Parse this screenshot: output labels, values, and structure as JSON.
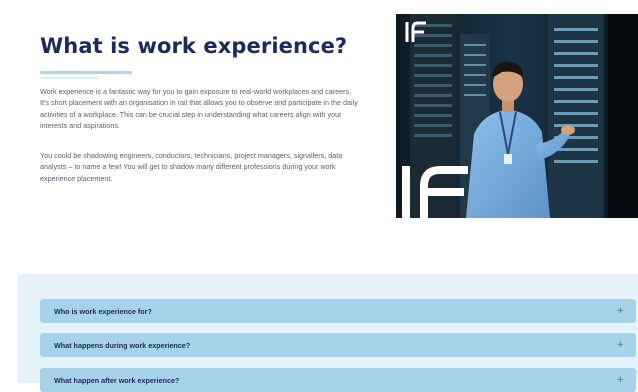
{
  "intro": {
    "heading": "What is work experience?",
    "paragraph_1": "Work experience is a fantastic way for you to gain exposure to real-world workplaces and careers. It's short placement with an organisation in rail that allows you to observe and participate in the daily activities of a workplace. This can be crucial step in understanding what careers align with your interests and aspirations.",
    "paragraph_2": "You could be shadowing engineers, conductors, technicians, project managers, signallers, data analysts – to name a few! You will get to shadow many different professions during your work experience placement."
  },
  "hero_image": {
    "icon": "person-in-server-room-photo",
    "logo_icon": "if-logo-icon"
  },
  "faq": {
    "items": [
      {
        "label": "Who is work experience for?",
        "toggle": "+"
      },
      {
        "label": "What happens during work experience?",
        "toggle": "+"
      },
      {
        "label": "What happen after work experience?",
        "toggle": "+"
      }
    ]
  },
  "colors": {
    "heading": "#1f2a5c",
    "body_text": "#5a5f6e",
    "accordion_bg": "#a6d2ea",
    "section_bg": "#e6f2f9"
  }
}
